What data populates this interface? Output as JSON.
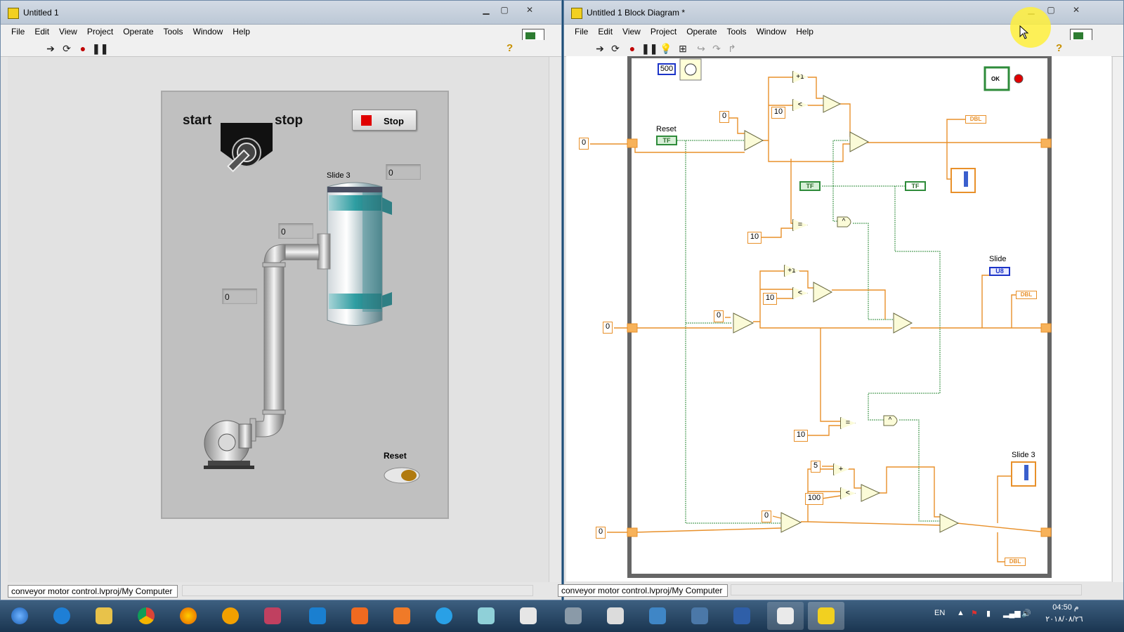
{
  "left_window": {
    "title": "Untitled 1",
    "menu": [
      "File",
      "Edit",
      "View",
      "Project",
      "Operate",
      "Tools",
      "Window",
      "Help"
    ],
    "status_path": "conveyor motor control.lvproj/My Computer",
    "front_panel": {
      "start_label": "start",
      "stop_label": "stop",
      "stop_button_label": "Stop",
      "slide_label": "Slide 3",
      "indicator_top": "0",
      "indicator_mid": "0",
      "indicator_left": "0",
      "reset_label": "Reset"
    }
  },
  "right_window": {
    "title": "Untitled 1 Block Diagram *",
    "menu": [
      "File",
      "Edit",
      "View",
      "Project",
      "Operate",
      "Tools",
      "Window",
      "Help"
    ],
    "status_path": "conveyor motor control.lvproj/My Computer",
    "diagram": {
      "wait_ms": "500",
      "reset_label": "Reset",
      "slide_label": "Slide",
      "slide3_label": "Slide 3",
      "const_zero": "0",
      "const_ten": "10",
      "const_five": "5",
      "const_hundred": "100",
      "tf": "TF",
      "dbl": "DBL",
      "u8": "U8",
      "ok": "OK",
      "plus_one": "+1",
      "lt": "<",
      "eq": "=",
      "and": "^",
      "plus": "+"
    }
  },
  "taskbar": {
    "lang": "EN",
    "time": "04:50 م",
    "date": "٢٠١٨/٠٨/٢٦"
  },
  "colors": {
    "wire_numeric": "#e8902a",
    "wire_boolean": "#2e8b3a",
    "panel": "#c0c0c0",
    "stop_red": "#e00000"
  }
}
